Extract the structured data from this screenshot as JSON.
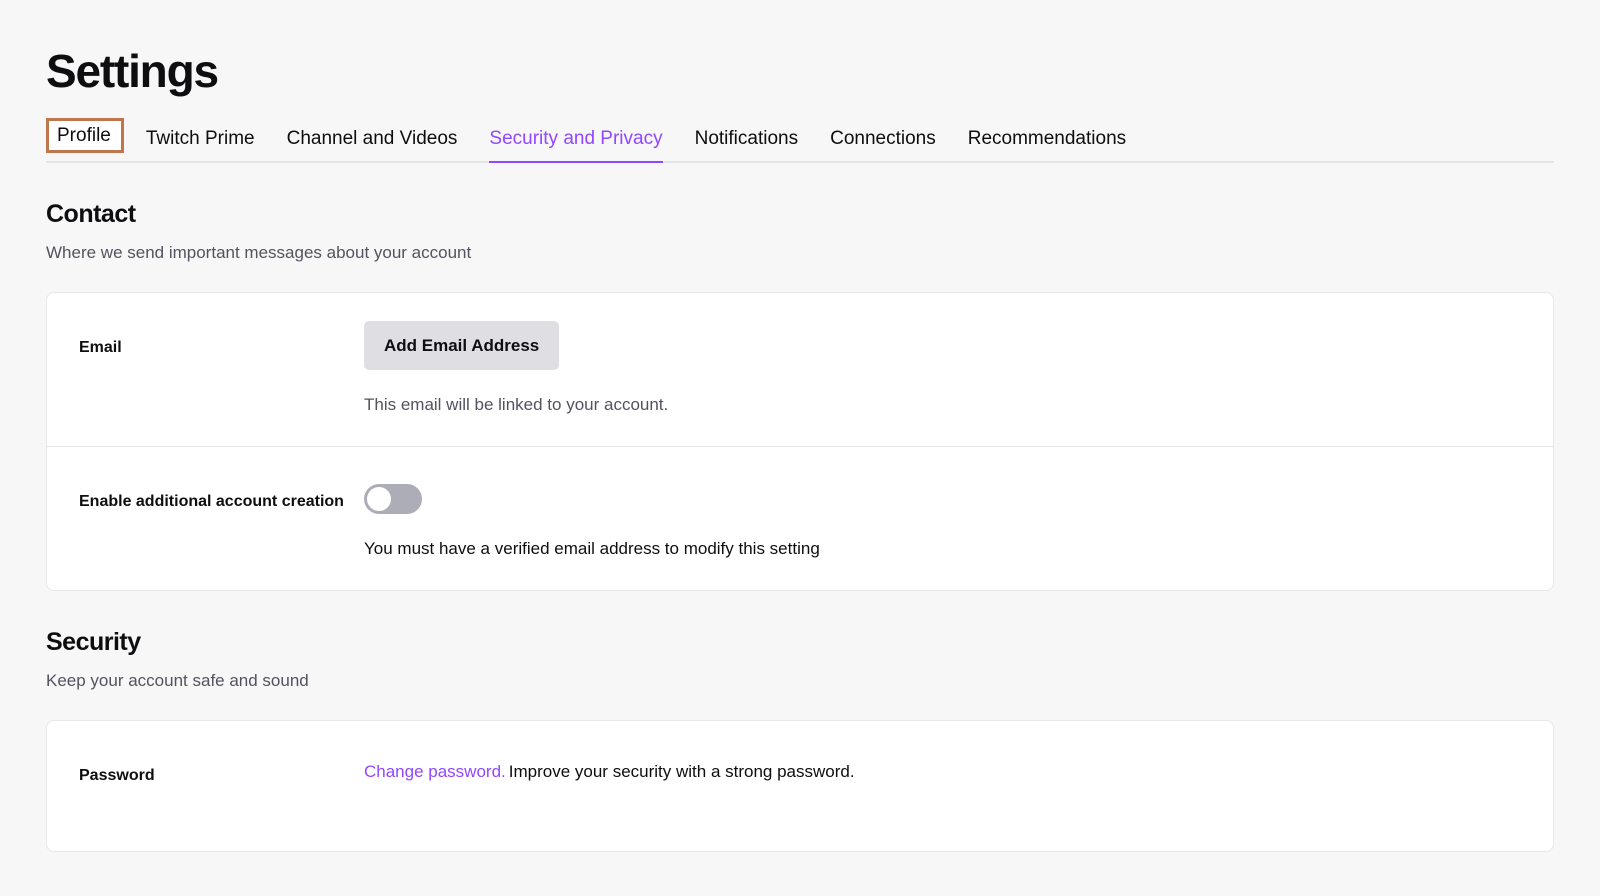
{
  "header": {
    "title": "Settings"
  },
  "tabs": [
    {
      "label": "Profile",
      "active": false,
      "focused": true
    },
    {
      "label": "Twitch Prime",
      "active": false,
      "focused": false
    },
    {
      "label": "Channel and Videos",
      "active": false,
      "focused": false
    },
    {
      "label": "Security and Privacy",
      "active": true,
      "focused": false
    },
    {
      "label": "Notifications",
      "active": false,
      "focused": false
    },
    {
      "label": "Connections",
      "active": false,
      "focused": false
    },
    {
      "label": "Recommendations",
      "active": false,
      "focused": false
    }
  ],
  "contact": {
    "title": "Contact",
    "subtitle": "Where we send important messages about your account",
    "email_row": {
      "label": "Email",
      "button_label": "Add Email Address",
      "hint": "This email will be linked to your account."
    },
    "account_creation_row": {
      "label": "Enable additional account creation",
      "toggle_state": "off",
      "hint": "You must have a verified email address to modify this setting"
    }
  },
  "security": {
    "title": "Security",
    "subtitle": "Keep your account safe and sound",
    "password_row": {
      "label": "Password",
      "link_label": "Change password.",
      "description": "Improve your security with a strong password."
    }
  },
  "colors": {
    "accent_purple": "#9147ff",
    "focus_box": "#c0764c",
    "page_background": "#f7f7f8",
    "card_background": "#ffffff",
    "toggle_track_off": "#adadb8",
    "button_background": "#dedee3"
  }
}
